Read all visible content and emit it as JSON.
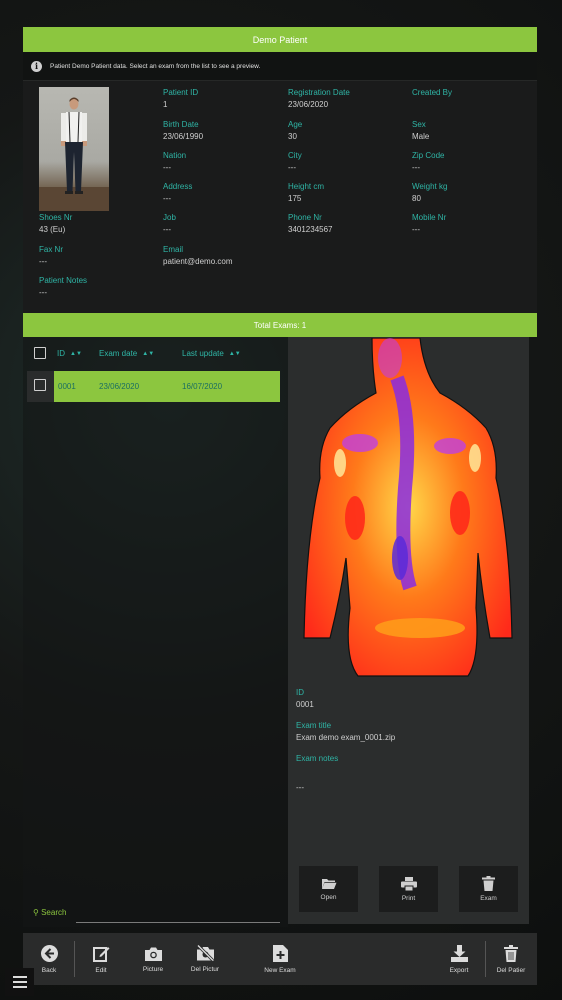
{
  "header": {
    "title": "Demo Patient",
    "info": "Patient Demo Patient data. Select an exam from the list to see a preview."
  },
  "patient": {
    "patient_id": {
      "label": "Patient ID",
      "value": "1"
    },
    "registration_date": {
      "label": "Registration Date",
      "value": "23/06/2020"
    },
    "created_by": {
      "label": "Created By",
      "value": ""
    },
    "birth_date": {
      "label": "Birth Date",
      "value": "23/06/1990"
    },
    "age": {
      "label": "Age",
      "value": "30"
    },
    "sex": {
      "label": "Sex",
      "value": "Male"
    },
    "nation": {
      "label": "Nation",
      "value": "---"
    },
    "city": {
      "label": "City",
      "value": "---"
    },
    "zip_code": {
      "label": "Zip Code",
      "value": "---"
    },
    "address": {
      "label": "Address",
      "value": "---"
    },
    "height": {
      "label": "Height cm",
      "value": "175"
    },
    "weight": {
      "label": "Weight kg",
      "value": "80"
    },
    "shoes": {
      "label": "Shoes Nr",
      "value": "43 (Eu)"
    },
    "job": {
      "label": "Job",
      "value": "---"
    },
    "phone": {
      "label": "Phone Nr",
      "value": "3401234567"
    },
    "mobile": {
      "label": "Mobile Nr",
      "value": "---"
    },
    "fax": {
      "label": "Fax Nr",
      "value": "---"
    },
    "email": {
      "label": "Email",
      "value": "patient@demo.com"
    },
    "notes": {
      "label": "Patient Notes",
      "value": "---"
    }
  },
  "exams": {
    "total_label": "Total Exams: 1",
    "columns": {
      "id": "ID",
      "date": "Exam date",
      "updated": "Last update"
    },
    "rows": [
      {
        "id": "0001",
        "date": "23/06/2020",
        "updated": "16/07/2020"
      }
    ],
    "search_label": "Search",
    "search_value": ""
  },
  "preview": {
    "id": {
      "label": "ID",
      "value": "0001"
    },
    "title": {
      "label": "Exam title",
      "value": "Exam demo exam_0001.zip"
    },
    "notes": {
      "label": "Exam notes",
      "value": "---"
    },
    "buttons": {
      "open": "Open",
      "print": "Print",
      "exam": "Exam"
    }
  },
  "toolbar": {
    "back": "Back",
    "edit": "Edit",
    "picture": "Picture",
    "del_picture": "Del Pictur",
    "new_exam": "New Exam",
    "export": "Export",
    "del_patient": "Del Patier"
  },
  "colors": {
    "accent_green": "#8cc63f",
    "label_teal": "#2fb5a6",
    "panel_dark": "#1a1b1b"
  }
}
